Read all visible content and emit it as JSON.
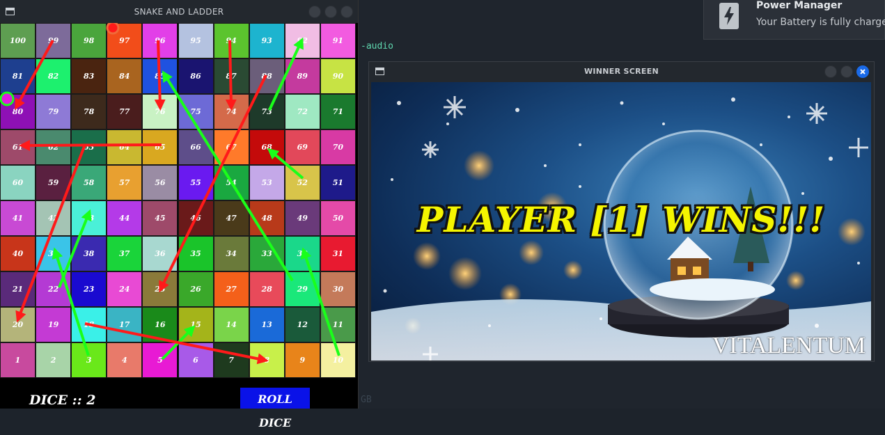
{
  "desktop": {
    "terminal_text_1": "-audio",
    "terminal_text_2": "GB"
  },
  "notification": {
    "title": "Power Manager",
    "body": "Your Battery is fully charged",
    "icon": "battery-charging-icon"
  },
  "snake_window": {
    "title": "SNAKE AND LADDER",
    "dice_label": "DICE :: 2",
    "roll_button": "ROLL DICE",
    "cells": [
      {
        "n": "100",
        "c": "#5e9e51"
      },
      {
        "n": "99",
        "c": "#7d6b9a"
      },
      {
        "n": "98",
        "c": "#4aa53c"
      },
      {
        "n": "97",
        "c": "#f24d1a"
      },
      {
        "n": "96",
        "c": "#e23fe8"
      },
      {
        "n": "95",
        "c": "#b4c2e0"
      },
      {
        "n": "94",
        "c": "#5bc42e"
      },
      {
        "n": "93",
        "c": "#1db4cf"
      },
      {
        "n": "92",
        "c": "#f1bde4"
      },
      {
        "n": "91",
        "c": "#f25be0"
      },
      {
        "n": "81",
        "c": "#1e3f8f"
      },
      {
        "n": "82",
        "c": "#1df06e"
      },
      {
        "n": "83",
        "c": "#4a2410"
      },
      {
        "n": "84",
        "c": "#a9641f"
      },
      {
        "n": "85",
        "c": "#1f52e0"
      },
      {
        "n": "86",
        "c": "#1a1470"
      },
      {
        "n": "87",
        "c": "#2a4a33"
      },
      {
        "n": "88",
        "c": "#6b5e7a"
      },
      {
        "n": "89",
        "c": "#c43a9e"
      },
      {
        "n": "90",
        "c": "#c7e344"
      },
      {
        "n": "80",
        "c": "#8e10b5"
      },
      {
        "n": "79",
        "c": "#8e7ad6"
      },
      {
        "n": "78",
        "c": "#3d2a1c"
      },
      {
        "n": "77",
        "c": "#4a1d1d"
      },
      {
        "n": "76",
        "c": "#c9f2c4"
      },
      {
        "n": "75",
        "c": "#6d6ad6"
      },
      {
        "n": "74",
        "c": "#d46a4a"
      },
      {
        "n": "73",
        "c": "#1e3a2a"
      },
      {
        "n": "72",
        "c": "#9fe8c2"
      },
      {
        "n": "71",
        "c": "#1a7a2e"
      },
      {
        "n": "61",
        "c": "#9e4a6a"
      },
      {
        "n": "62",
        "c": "#4a8a6e"
      },
      {
        "n": "63",
        "c": "#1a6e4a"
      },
      {
        "n": "64",
        "c": "#c9b830"
      },
      {
        "n": "65",
        "c": "#d9a820"
      },
      {
        "n": "66",
        "c": "#5e4e8a"
      },
      {
        "n": "67",
        "c": "#ff7a2a"
      },
      {
        "n": "68",
        "c": "#c40a0a"
      },
      {
        "n": "69",
        "c": "#e2485a"
      },
      {
        "n": "70",
        "c": "#d83aa4"
      },
      {
        "n": "60",
        "c": "#8ad4c0"
      },
      {
        "n": "59",
        "c": "#5a2040"
      },
      {
        "n": "58",
        "c": "#3aa878"
      },
      {
        "n": "57",
        "c": "#e8a030"
      },
      {
        "n": "56",
        "c": "#9a8ca4"
      },
      {
        "n": "55",
        "c": "#6a1af0"
      },
      {
        "n": "54",
        "c": "#1aa840"
      },
      {
        "n": "53",
        "c": "#c4a8e8"
      },
      {
        "n": "52",
        "c": "#d8c44a"
      },
      {
        "n": "51",
        "c": "#1e1a8a"
      },
      {
        "n": "41",
        "c": "#c84ad4"
      },
      {
        "n": "42",
        "c": "#a4c4b4"
      },
      {
        "n": "43",
        "c": "#4af0d8"
      },
      {
        "n": "44",
        "c": "#b43ae8"
      },
      {
        "n": "45",
        "c": "#9e4a6a"
      },
      {
        "n": "46",
        "c": "#6a1a1a"
      },
      {
        "n": "47",
        "c": "#4a3a1a"
      },
      {
        "n": "48",
        "c": "#b83a1a"
      },
      {
        "n": "49",
        "c": "#6a3a7a"
      },
      {
        "n": "50",
        "c": "#e44aa8"
      },
      {
        "n": "40",
        "c": "#c8351a"
      },
      {
        "n": "39",
        "c": "#3ac4e8"
      },
      {
        "n": "38",
        "c": "#3a2ab0"
      },
      {
        "n": "37",
        "c": "#1ad43a"
      },
      {
        "n": "36",
        "c": "#a8d8d0"
      },
      {
        "n": "35",
        "c": "#1ac42a"
      },
      {
        "n": "34",
        "c": "#6a7a3a"
      },
      {
        "n": "33",
        "c": "#2aa83a"
      },
      {
        "n": "32",
        "c": "#1ad88a"
      },
      {
        "n": "31",
        "c": "#e81a30"
      },
      {
        "n": "21",
        "c": "#5a2a7a"
      },
      {
        "n": "22",
        "c": "#b43ad4"
      },
      {
        "n": "23",
        "c": "#1a0ad0"
      },
      {
        "n": "24",
        "c": "#e84ad4"
      },
      {
        "n": "25",
        "c": "#8a7a3a"
      },
      {
        "n": "26",
        "c": "#3aa82a"
      },
      {
        "n": "27",
        "c": "#f4601a"
      },
      {
        "n": "28",
        "c": "#e84a5a"
      },
      {
        "n": "29",
        "c": "#1ae87a"
      },
      {
        "n": "30",
        "c": "#c47a5a"
      },
      {
        "n": "20",
        "c": "#b4b47a"
      },
      {
        "n": "19",
        "c": "#c43ad4"
      },
      {
        "n": "18",
        "c": "#3af0e8"
      },
      {
        "n": "17",
        "c": "#3ab4c4"
      },
      {
        "n": "16",
        "c": "#1a8a1a"
      },
      {
        "n": "15",
        "c": "#a4b41a"
      },
      {
        "n": "14",
        "c": "#7ad44a"
      },
      {
        "n": "13",
        "c": "#1a6ad8"
      },
      {
        "n": "12",
        "c": "#1a5a3a"
      },
      {
        "n": "11",
        "c": "#4a9a4a"
      },
      {
        "n": "1",
        "c": "#c84a9e"
      },
      {
        "n": "2",
        "c": "#a8d4a8"
      },
      {
        "n": "3",
        "c": "#6ae81a"
      },
      {
        "n": "4",
        "c": "#e87a6a"
      },
      {
        "n": "5",
        "c": "#e81ad4"
      },
      {
        "n": "6",
        "c": "#a85ae8"
      },
      {
        "n": "7",
        "c": "#1e3a1e"
      },
      {
        "n": "8",
        "c": "#c8f04a"
      },
      {
        "n": "9",
        "c": "#e8841a"
      },
      {
        "n": "10",
        "c": "#f4f0a0"
      }
    ],
    "snakes_color": "#ff1a1a",
    "ladders_color": "#1aff1a"
  },
  "winner_window": {
    "title": "WINNER SCREEN",
    "message": "PLAYER [1] WINS!!!",
    "watermark": "VITALENTUM"
  }
}
